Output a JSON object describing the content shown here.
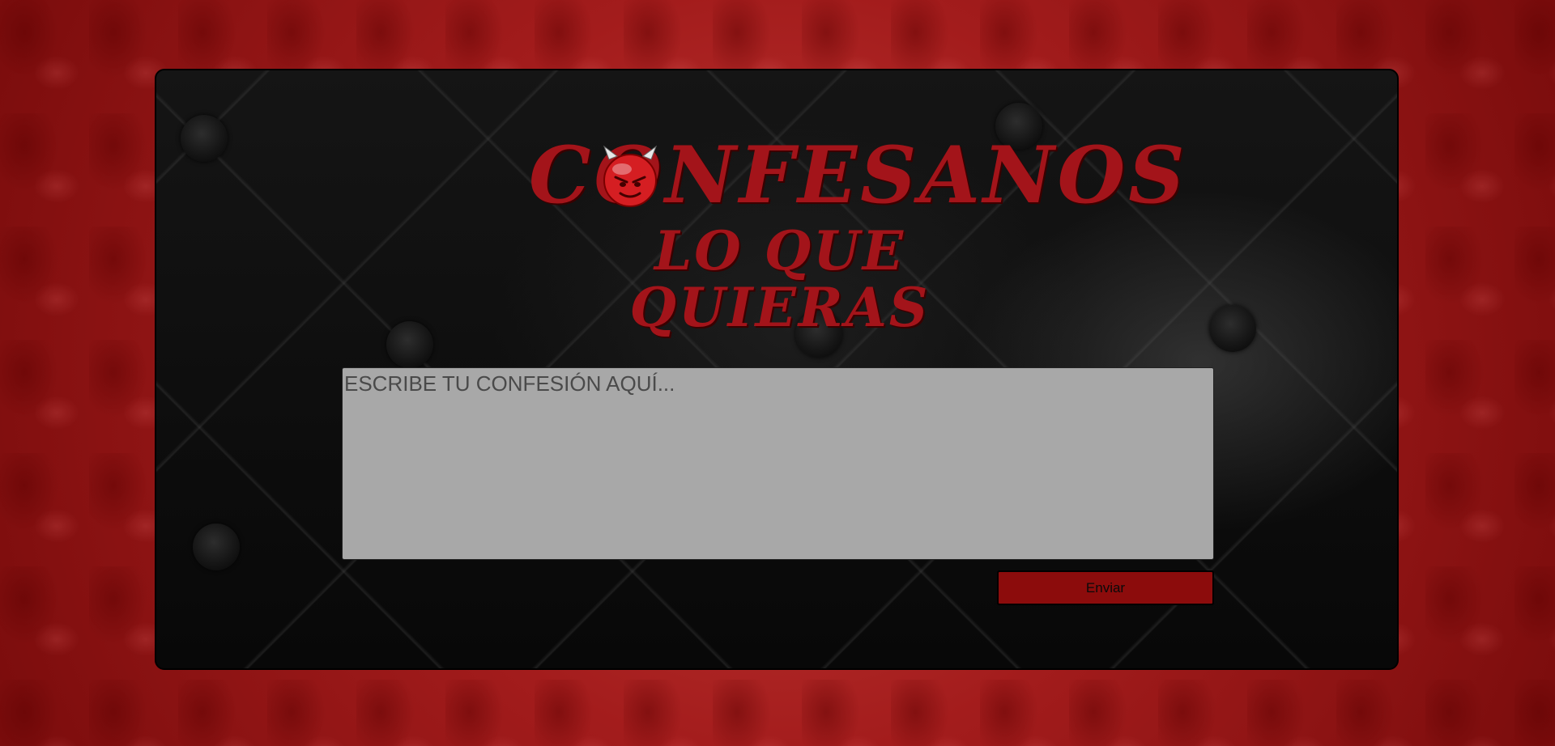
{
  "logo": {
    "line1": "CONFESANOS",
    "line2": "LO QUE QUIERAS",
    "icon": "devil-emoji-icon",
    "color": "#a3141a"
  },
  "form": {
    "confession_placeholder": "ESCRIBE TU CONFESIÓN AQUÍ...",
    "confession_value": "",
    "submit_label": "Enviar"
  },
  "colors": {
    "background": "#a01818",
    "panel": "#0e0e0e",
    "input": "#a8a8a8",
    "button": "#8c0c0c"
  }
}
